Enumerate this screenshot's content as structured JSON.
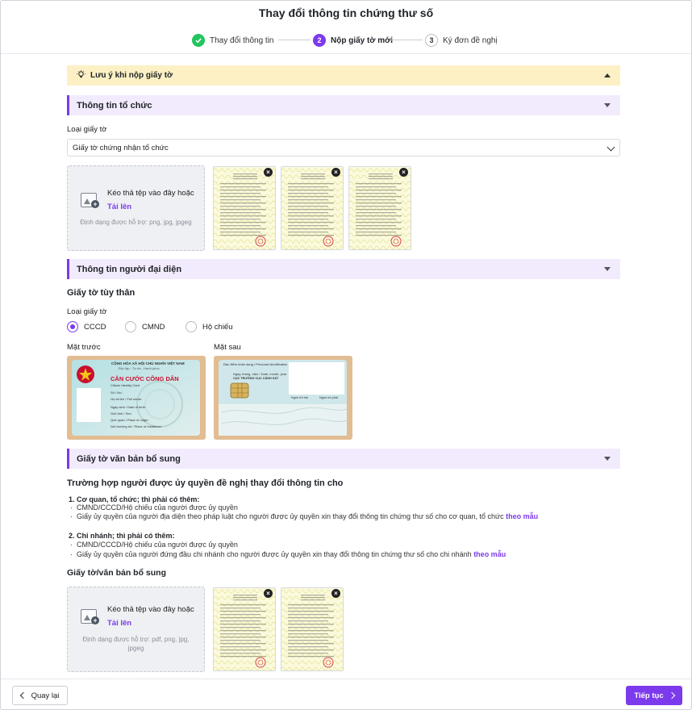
{
  "header": {
    "title": "Thay đổi thông tin chứng thư số",
    "steps": [
      {
        "number": "",
        "label": "Thay đổi thông tin",
        "state": "done"
      },
      {
        "number": "2",
        "label": "Nộp giấy tờ mới",
        "state": "active"
      },
      {
        "number": "3",
        "label": "Ký đơn đề nghị",
        "state": "idle"
      }
    ]
  },
  "notice": {
    "label": "Lưu ý khi nộp giấy tờ",
    "icon": "lightbulb-icon"
  },
  "org_section": {
    "title": "Thông tin tổ chức",
    "doc_type_label": "Loại giấy tờ",
    "doc_type_value": "Giấy tờ chứng nhận tổ chức",
    "dropzone": {
      "text": "Kéo thả tệp vào đây hoặc",
      "link": "Tải lên",
      "hint": "Định dạng được hỗ trợ: png, jpg, jpgeg"
    },
    "thumbnails": 3
  },
  "rep_section": {
    "title": "Thông tin người đại diện",
    "subtitle": "Giấy tờ tùy thân",
    "doc_type_label": "Loại giấy tờ",
    "options": [
      "CCCD",
      "CMND",
      "Hộ chiếu"
    ],
    "selected": "CCCD",
    "front_label": "Mặt trước",
    "back_label": "Mặt sau",
    "card_front": {
      "header1": "CỘNG HÒA XÃ HỘI CHỦ NGHĨA VIỆT NAM",
      "header2": "Độc lập - Tự do - Hạnh phúc",
      "title": "CĂN CƯỚC CÔNG DÂN",
      "subtitle": "Citizen Identity Card",
      "fields": [
        "Số / No.:",
        "Họ và tên / Full name:",
        "Ngày sinh / Date of birth:",
        "Giới tính / Sex:",
        "Quê quán / Place of origin:",
        "Nơi thường trú / Place of residence:"
      ]
    },
    "card_back": {
      "line1": "Đặc điểm nhân dạng / Personal identification",
      "line2": "Ngày, tháng, năm / Date, month, year",
      "line3": "CỤC TRƯỞNG CỤC CẢNH SÁT",
      "left_label": "Ngón trỏ trái",
      "right_label": "Ngón trỏ phải"
    }
  },
  "extra_section": {
    "title": "Giấy tờ văn bản bổ sung",
    "heading": "Trường hợp người được ủy quyền đề nghị thay đổi thông tin cho",
    "case1_title": "1. Cơ quan, tổ chức; thì phải có thêm:",
    "case1_item1": "CMND/CCCD/Hộ chiếu của người được ủy quyền",
    "case1_item2": "Giấy ủy quyền của người địa diện theo pháp luật cho người được ủy quyền xin thay đổi thông tin chứng thư số cho cơ quan, tổ chức",
    "case1_link": "theo mẫu",
    "case2_title": "2. Chi nhánh; thì phải có thêm:",
    "case2_item1": "CMND/CCCD/Hộ chiếu của người được ủy quyền",
    "case2_item2": "Giấy ủy quyền của người đứng đầu chi nhánh cho người được ủy quyền xin thay đổi thông tin chứng thư số cho chi nhánh",
    "case2_link": "theo mẫu",
    "upload_label": "Giấy tờ/văn bản bổ sung",
    "dropzone": {
      "text": "Kéo thả tệp vào đây hoặc",
      "link": "Tải lên",
      "hint_line1": "Định dạng được hỗ trợ: pdf, png, jpg,",
      "hint_line2": "jpgeg"
    },
    "thumbnails": 2
  },
  "footer": {
    "back": "Quay lại",
    "next": "Tiếp tục"
  },
  "colors": {
    "accent": "#7c3aed",
    "success": "#22c55e",
    "notice_bg": "#fdf0c4",
    "section_bg": "#f2ebfd"
  }
}
